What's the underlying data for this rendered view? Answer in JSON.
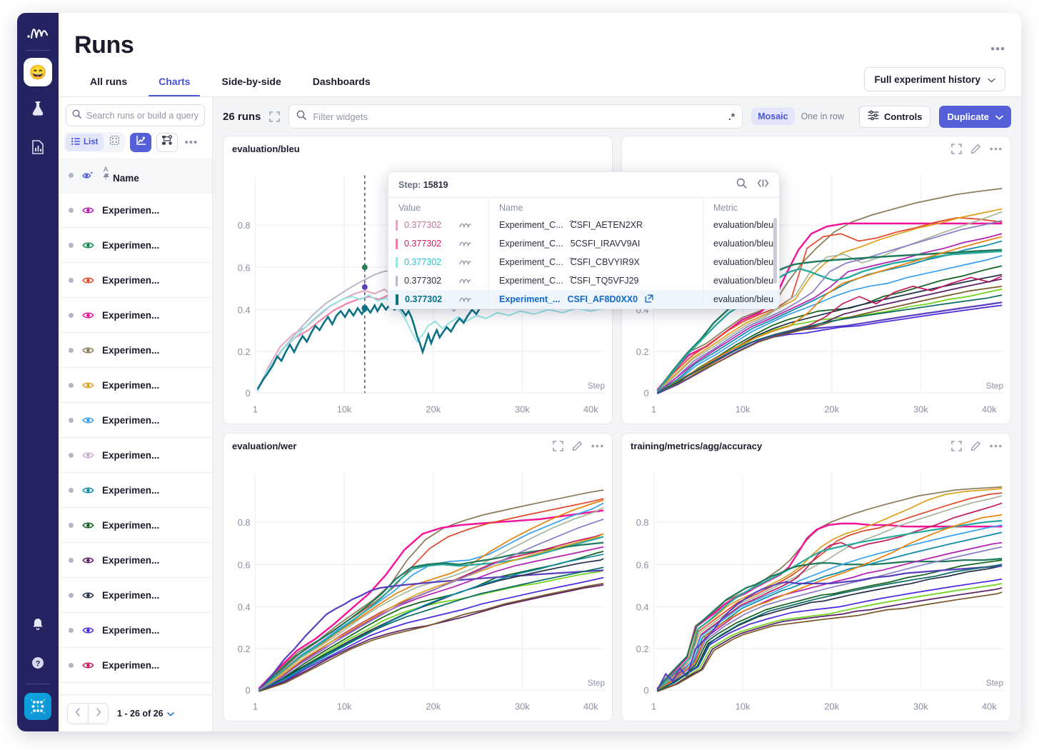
{
  "rail": {
    "logo_icon": "waveform-logo-icon",
    "avatar_emoji": "😄",
    "items": [
      {
        "name": "experiments",
        "icon": "flask-icon"
      },
      {
        "name": "reports",
        "icon": "document-chart-icon"
      }
    ],
    "bottom_items": [
      {
        "name": "notifications",
        "icon": "bell-icon"
      },
      {
        "name": "help",
        "icon": "question-circle-icon"
      }
    ],
    "app_icon": "app-grid-icon"
  },
  "header": {
    "title": "Runs",
    "more_icon": "ellipsis-icon",
    "history_button": "Full experiment history",
    "history_chevron": "chevron-down-icon",
    "tabs": [
      {
        "label": "All runs",
        "active": false
      },
      {
        "label": "Charts",
        "active": true
      },
      {
        "label": "Side-by-side",
        "active": false
      },
      {
        "label": "Dashboards",
        "active": false
      }
    ]
  },
  "sidebar": {
    "search_placeholder": "Search runs or build a query",
    "search_icon": "search-icon",
    "view_toolbar": {
      "list_label": "List",
      "list_icon": "list-icon",
      "grid_icon": "grid-icon",
      "chart_icon": "line-chart-icon",
      "tree_icon": "node-tree-icon",
      "more_icon": "ellipsis-icon"
    },
    "header_row": {
      "sort_indicator": "A",
      "pin_icon": "pin-icon",
      "eye_icon": "eye-sparkle-icon",
      "name_label": "Name"
    },
    "rows": [
      {
        "name": "Experimen...",
        "color": "#b321b3"
      },
      {
        "name": "Experimen...",
        "color": "#0f8a4f"
      },
      {
        "name": "Experimen...",
        "color": "#e04a2a"
      },
      {
        "name": "Experimen...",
        "color": "#f5129a"
      },
      {
        "name": "Experimen...",
        "color": "#8b7a56"
      },
      {
        "name": "Experimen...",
        "color": "#e0a020"
      },
      {
        "name": "Experimen...",
        "color": "#3aa0f0"
      },
      {
        "name": "Experimen...",
        "color": "#cbaad4"
      },
      {
        "name": "Experimen...",
        "color": "#0d8ba8"
      },
      {
        "name": "Experimen...",
        "color": "#13631f"
      },
      {
        "name": "Experimen...",
        "color": "#5c2168"
      },
      {
        "name": "Experimen...",
        "color": "#243048"
      },
      {
        "name": "Experimen...",
        "color": "#4b2be0"
      },
      {
        "name": "Experimen...",
        "color": "#c41b5e"
      }
    ],
    "pager": {
      "prev_icon": "chevron-left-icon",
      "next_icon": "chevron-right-icon",
      "range_label": "1 - 26 of 26",
      "range_chevron": "chevron-down-icon"
    }
  },
  "charts_toolbar": {
    "runs_count": "26 runs",
    "expand_icon": "expand-icon",
    "filter_placeholder": "Filter widgets",
    "filter_value": "",
    "filter_search_icon": "search-icon",
    "regex_icon": ".*",
    "layout_options": [
      {
        "label": "Mosaic",
        "active": true
      },
      {
        "label": "One in row",
        "active": false
      }
    ],
    "controls_label": "Controls",
    "controls_icon": "sliders-icon",
    "duplicate_label": "Duplicate",
    "duplicate_chevron": "chevron-down-icon"
  },
  "tooltip": {
    "step_prefix": "Step:",
    "step_value": "15819",
    "search_icon": "search-icon",
    "code_icon": "code-brackets-icon",
    "columns": {
      "value": "Value",
      "name": "Name",
      "metric": "Metric"
    },
    "rows": [
      {
        "value": "0.377302",
        "color": "#c0739a",
        "swatch": "#e0a8c0",
        "name_prefix": "Experiment_C...",
        "name_suffix": "͠CSFI_AETEN2XR",
        "metric": "evaluation/bleu",
        "highlighted": false
      },
      {
        "value": "0.377302",
        "color": "#d81b60",
        "swatch": "#f07ba4",
        "name_prefix": "Experiment_C...",
        "name_suffix": "5CSFI_IRAVV9AI",
        "metric": "evaluation/bleu",
        "highlighted": false
      },
      {
        "value": "0.377302",
        "color": "#1fc8cf",
        "swatch": "#97e6e8",
        "name_prefix": "Experiment_C...",
        "name_suffix": "͠CSFI_CBVYIR9X",
        "metric": "evaluation/bleu",
        "highlighted": false
      },
      {
        "value": "0.377302",
        "color": "#2b2e3e",
        "swatch": "#b6bac6",
        "name_prefix": "Experiment_C...",
        "name_suffix": "͠CSFI_TQ5VFJ29",
        "metric": "evaluation/bleu",
        "highlighted": false
      },
      {
        "value": "0.377302",
        "color": "#0b7285",
        "swatch": "#0b7285",
        "name_prefix": "Experiment_...",
        "name_suffix": "CSFI_AF8D0XX0",
        "metric": "evaluation/bleu",
        "highlighted": true,
        "external_icon": "external-link-icon"
      }
    ]
  },
  "panels": [
    {
      "title": "evaluation/bleu",
      "expand_icon": "expand-icon",
      "edit_icon": "pencil-icon",
      "more_icon": "ellipsis-icon"
    },
    {
      "title": "",
      "expand_icon": "expand-icon",
      "edit_icon": "pencil-icon",
      "more_icon": "ellipsis-icon"
    },
    {
      "title": "evaluation/wer",
      "expand_icon": "expand-icon",
      "edit_icon": "pencil-icon",
      "more_icon": "ellipsis-icon"
    },
    {
      "title": "training/metrics/agg/accuracy",
      "expand_icon": "expand-icon",
      "edit_icon": "pencil-icon",
      "more_icon": "ellipsis-icon"
    }
  ],
  "chart_data": [
    {
      "type": "line",
      "title": "evaluation/bleu",
      "xlabel": "Step",
      "ylabel": "",
      "xticks": [
        "1",
        "10k",
        "20k",
        "30k",
        "40k"
      ],
      "yticks": [
        "0",
        "0.2",
        "0.4",
        "0.6",
        "0.8"
      ],
      "xlim": [
        0,
        50000
      ],
      "ylim": [
        0,
        0.92
      ],
      "grid": true,
      "legend": "none",
      "cursor_step": 15819,
      "cursor_values": [
        0.377302,
        0.377302,
        0.377302,
        0.377302,
        0.377302
      ],
      "series": [
        {
          "name": "CSFI_AF8D0XX0",
          "color": "#0b7285",
          "values": [
            0.01,
            0.1,
            0.16,
            0.22,
            0.19,
            0.26,
            0.31,
            0.34,
            0.4,
            0.39,
            0.41,
            0.38,
            0.4,
            0.38,
            0.28,
            0.21,
            0.33,
            0.29,
            0.35,
            0.4,
            0.44,
            0.49,
            0.52,
            0.55
          ]
        },
        {
          "name": "CSFI_CBVYIR9X",
          "color": "#97e6e8",
          "values": [
            0.01,
            0.09,
            0.15,
            0.2,
            0.21,
            0.27,
            0.33,
            0.37,
            0.42,
            0.44,
            0.45,
            0.46,
            0.44,
            0.42,
            0.38,
            0.25,
            0.2,
            0.3,
            0.36,
            0.4,
            0.43,
            0.44,
            0.45,
            0.46
          ]
        },
        {
          "name": "CSFI_TQ5VFJ29",
          "color": "#b6bac6",
          "values": [
            0.01,
            0.09,
            0.14,
            0.21,
            0.22,
            0.28,
            0.34,
            0.41,
            0.45,
            0.47,
            0.49,
            0.52,
            0.55,
            0.58,
            0.6,
            0.59,
            0.57,
            0.55,
            0.53,
            0.52,
            0.5,
            0.49,
            0.48,
            0.47
          ]
        },
        {
          "name": "CSFI_AETEN2XR",
          "color": "#e0a8c0",
          "values": [
            0.01,
            0.08,
            0.13,
            0.19,
            0.23,
            0.29,
            0.35,
            0.4,
            0.43,
            0.44,
            0.45,
            0.46,
            0.47,
            0.47,
            0.48,
            0.47,
            0.46,
            0.46,
            0.46,
            0.46,
            0.46,
            0.45,
            0.45,
            0.45
          ]
        },
        {
          "name": "CSFI_IRAVV9AI",
          "color": "#f07ba4",
          "values": [
            0.01,
            0.08,
            0.12,
            0.18,
            0.22,
            0.27,
            0.32,
            0.37,
            0.41,
            0.43,
            0.44,
            0.45,
            0.45,
            0.45,
            0.45,
            0.45,
            0.46,
            0.46,
            0.47,
            0.47,
            0.47,
            0.47,
            0.47,
            0.47
          ]
        }
      ]
    },
    {
      "type": "line",
      "title": "",
      "xlabel": "Step",
      "xticks": [
        "1",
        "10k",
        "20k",
        "30k",
        "40k"
      ],
      "yticks": [
        "0",
        "0.2",
        "0.4"
      ],
      "xlim": [
        0,
        50000
      ],
      "ylim": [
        0,
        0.92
      ],
      "grid": true,
      "legend": "none",
      "series_count": 26
    },
    {
      "type": "line",
      "title": "evaluation/wer",
      "xlabel": "Step",
      "xticks": [
        "1",
        "10k",
        "20k",
        "30k",
        "40k"
      ],
      "yticks": [
        "0",
        "0.2",
        "0.4",
        "0.6",
        "0.8"
      ],
      "xlim": [
        0,
        50000
      ],
      "ylim": [
        0,
        0.92
      ],
      "grid": true,
      "legend": "none",
      "series_count": 26
    },
    {
      "type": "line",
      "title": "training/metrics/agg/accuracy",
      "xlabel": "Step",
      "xticks": [
        "1",
        "10k",
        "20k",
        "30k",
        "40k"
      ],
      "yticks": [
        "0",
        "0.2",
        "0.4",
        "0.6",
        "0.8"
      ],
      "xlim": [
        0,
        50000
      ],
      "ylim": [
        0,
        0.92
      ],
      "grid": true,
      "legend": "none",
      "series_count": 26
    }
  ]
}
